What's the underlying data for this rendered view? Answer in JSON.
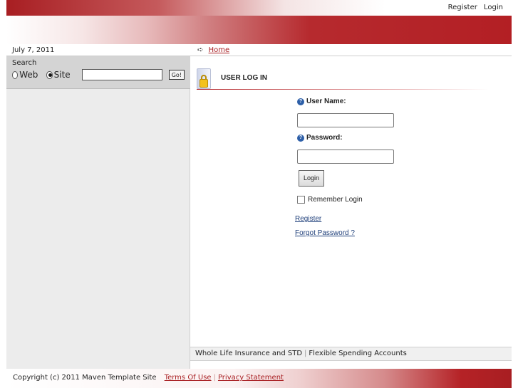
{
  "header": {
    "links": [
      "Register",
      "Login"
    ]
  },
  "sidebar": {
    "date": "July 7, 2011",
    "search": {
      "title": "Search",
      "option_web": "Web",
      "option_site": "Site",
      "selected": "Site",
      "input_value": "",
      "go_label": "Go!"
    }
  },
  "breadcrumb": {
    "arrow": "➪",
    "home": "Home"
  },
  "login": {
    "title": "USER LOG IN",
    "username_label": "User Name:",
    "password_label": "Password:",
    "username_value": "",
    "password_value": "",
    "login_button": "Login",
    "remember_label": "Remember Login",
    "register_link": "Register",
    "forgot_link": "Forgot Password ?"
  },
  "subfooter": {
    "links": [
      "Whole Life Insurance and STD",
      "Flexible Spending Accounts"
    ]
  },
  "footer": {
    "copyright": "Copyright (c) 2011 Maven Template Site",
    "terms": "Terms Of Use",
    "privacy": "Privacy Statement"
  },
  "colors": {
    "brand_red": "#a81e22",
    "link_blue": "#1f3f7a"
  }
}
